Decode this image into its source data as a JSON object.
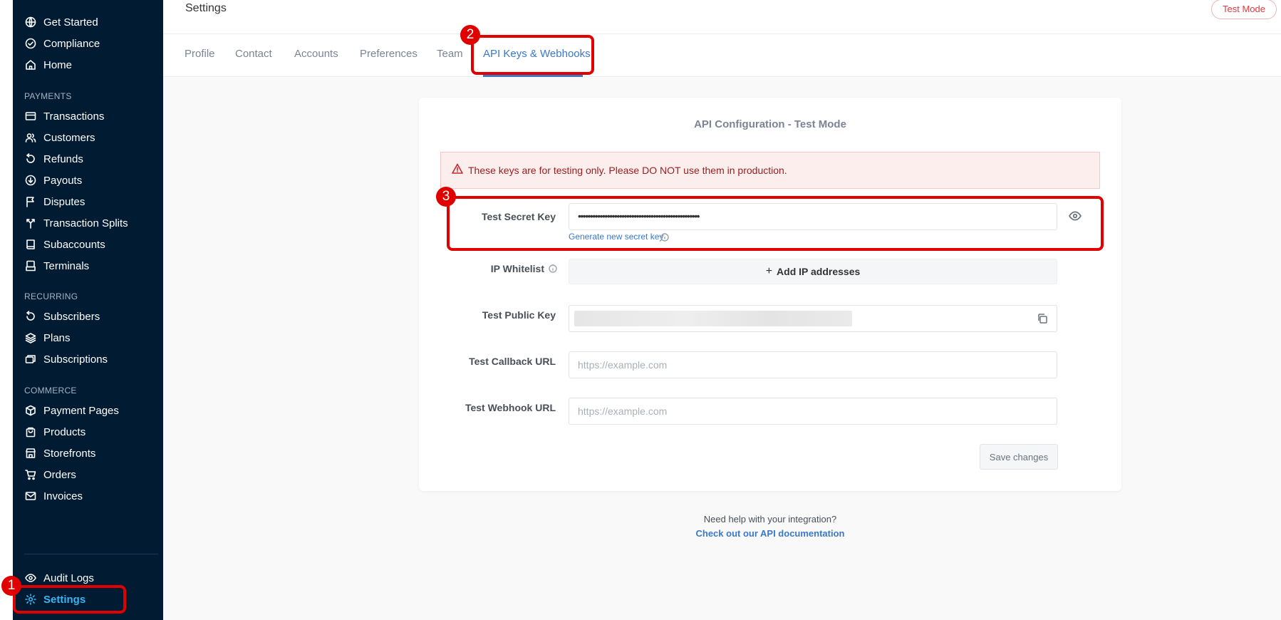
{
  "sidebar": {
    "top_items": [
      {
        "label": "Get Started",
        "icon": "globe-icon"
      },
      {
        "label": "Compliance",
        "icon": "check-circle-icon"
      },
      {
        "label": "Home",
        "icon": "home-icon"
      }
    ],
    "sections": [
      {
        "heading": "PAYMENTS",
        "items": [
          {
            "label": "Transactions",
            "icon": "card-icon"
          },
          {
            "label": "Customers",
            "icon": "users-icon"
          },
          {
            "label": "Refunds",
            "icon": "refresh-icon"
          },
          {
            "label": "Payouts",
            "icon": "download-circle-icon"
          },
          {
            "label": "Disputes",
            "icon": "flag-icon"
          },
          {
            "label": "Transaction Splits",
            "icon": "split-icon"
          },
          {
            "label": "Subaccounts",
            "icon": "book-icon"
          },
          {
            "label": "Terminals",
            "icon": "terminal-icon"
          }
        ]
      },
      {
        "heading": "RECURRING",
        "items": [
          {
            "label": "Subscribers",
            "icon": "refresh-icon"
          },
          {
            "label": "Plans",
            "icon": "layers-icon"
          },
          {
            "label": "Subscriptions",
            "icon": "stack-icon"
          }
        ]
      },
      {
        "heading": "COMMERCE",
        "items": [
          {
            "label": "Payment Pages",
            "icon": "box-icon"
          },
          {
            "label": "Products",
            "icon": "bag-icon"
          },
          {
            "label": "Storefronts",
            "icon": "store-icon"
          },
          {
            "label": "Orders",
            "icon": "cart-icon"
          },
          {
            "label": "Invoices",
            "icon": "mail-icon"
          }
        ]
      }
    ],
    "bottom_items": [
      {
        "label": "Audit Logs",
        "icon": "eye-icon"
      },
      {
        "label": "Settings",
        "icon": "gear-icon",
        "active": true
      }
    ]
  },
  "header": {
    "title": "Settings",
    "mode_badge": "Test Mode"
  },
  "tabs": [
    {
      "label": "Profile"
    },
    {
      "label": "Contact"
    },
    {
      "label": "Accounts"
    },
    {
      "label": "Preferences"
    },
    {
      "label": "Team"
    },
    {
      "label": "API Keys & Webhooks",
      "active": true
    }
  ],
  "api_config": {
    "title": "API Configuration - Test Mode",
    "alert": "These keys are for testing only. Please DO NOT use them in production.",
    "secret_key": {
      "label": "Test Secret Key",
      "value": "••••••••••••••••••••••••••••••••••••••••••••••••••",
      "generate_link": "Generate new secret key"
    },
    "ip_whitelist": {
      "label": "IP Whitelist",
      "button": "Add IP addresses"
    },
    "public_key": {
      "label": "Test Public Key"
    },
    "callback_url": {
      "label": "Test Callback URL",
      "placeholder": "https://example.com"
    },
    "webhook_url": {
      "label": "Test Webhook URL",
      "placeholder": "https://example.com"
    },
    "save_button": "Save changes"
  },
  "help": {
    "text": "Need help with your integration?",
    "link": "Check out our API documentation"
  },
  "annotations": [
    "1",
    "2",
    "3"
  ],
  "colors": {
    "sidebar_bg": "#011b33",
    "accent": "#3a78c9",
    "active_nav": "#3bb4f2",
    "annotation_red": "#e00000",
    "alert_bg": "#fdeeee"
  }
}
